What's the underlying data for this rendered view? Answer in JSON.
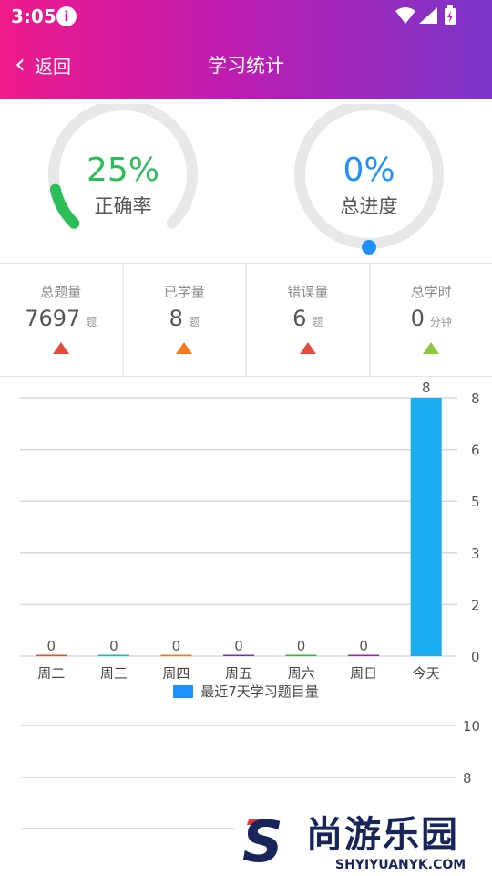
{
  "status_bar": {
    "time": "3:05"
  },
  "header": {
    "back_label": "返回",
    "title": "学习统计"
  },
  "rings": [
    {
      "value": "25%",
      "label": "正确率",
      "fraction": 0.25,
      "color": "#2dbe5a"
    },
    {
      "value": "0%",
      "label": "总进度",
      "fraction": 0.0,
      "color": "#1e90ff"
    }
  ],
  "stats": [
    {
      "label": "总题量",
      "value": "7697",
      "unit": "题",
      "color": "#e54d42"
    },
    {
      "label": "已学量",
      "value": "8",
      "unit": "题",
      "color": "#f37b1d"
    },
    {
      "label": "错误量",
      "value": "6",
      "unit": "题",
      "color": "#e54d42"
    },
    {
      "label": "总学时",
      "value": "0",
      "unit": "分钟",
      "color": "#8dc63f"
    }
  ],
  "chart_data": [
    {
      "type": "bar",
      "categories": [
        "周二",
        "周三",
        "周四",
        "周五",
        "周六",
        "周日",
        "今天"
      ],
      "series": [
        {
          "name": "最近7天学习题目量",
          "values": [
            0,
            0,
            0,
            0,
            0,
            0,
            8
          ],
          "color": "#1e90ff"
        }
      ],
      "bar_colors": [
        "#e54d42",
        "#1cbbb4",
        "#f37b1d",
        "#6739b6",
        "#39b54a",
        "#9c26b0",
        "#1cacf0"
      ],
      "y_ticks": [
        "8",
        "6",
        "5",
        "3",
        "2",
        "0"
      ],
      "ylim": [
        0,
        8
      ],
      "grid": true,
      "data_labels": true,
      "legend_position": "bottom-center"
    },
    {
      "type": "bar",
      "y_ticks": [
        "10",
        "8"
      ],
      "grid": true
    }
  ],
  "watermark": {
    "brand": "尚游乐园",
    "url": "SHYIYUANYK.COM"
  }
}
